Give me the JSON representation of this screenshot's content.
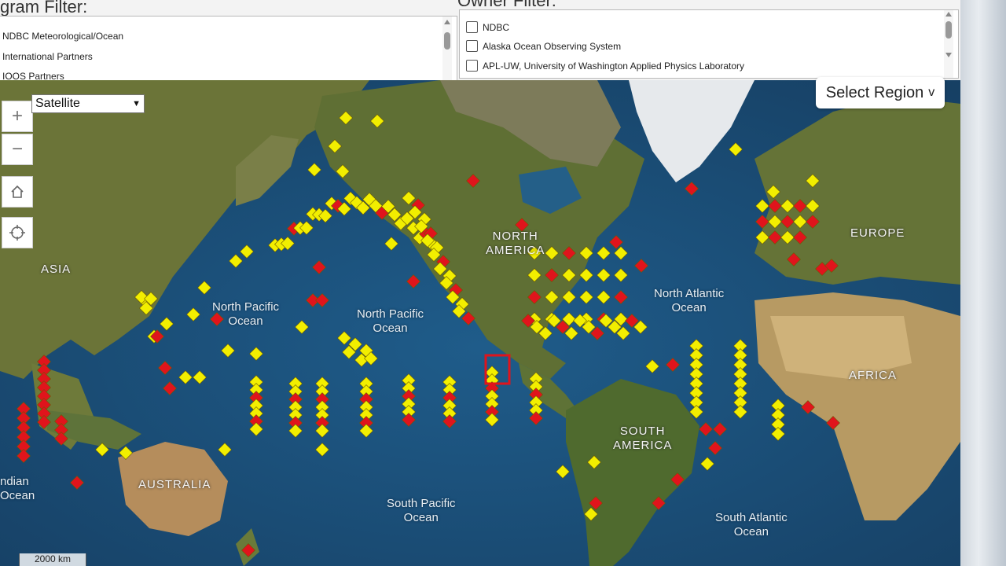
{
  "program_filter": {
    "title": "gram Filter:",
    "options": [
      "NDBC Meteorological/Ocean",
      "International Partners",
      "IOOS Partners"
    ]
  },
  "owner_filter": {
    "title": "Owner Filter:",
    "options": [
      "NDBC",
      "Alaska Ocean Observing System",
      "APL-UW, University of Washington Applied Physics Laboratory"
    ]
  },
  "map": {
    "basemap_select": "Satellite",
    "region_button": "Select Region",
    "region_chevron": "v",
    "zoom_in": "+",
    "zoom_out": "−",
    "scale_label": "2000 km",
    "labels": {
      "asia": "ASIA",
      "north_america": "NORTH\nAMERICA",
      "europe": "EUROPE",
      "africa": "AFRICA",
      "south_america": "SOUTH\nAMERICA",
      "australia": "AUSTRALIA",
      "north_pacific_w": "North Pacific\nOcean",
      "north_pacific_e": "North Pacific\nOcean",
      "north_atlantic": "North Atlantic\nOcean",
      "south_pacific": "South Pacific\nOcean",
      "south_atlantic": "South Atlantic\nOcean",
      "indian": "ndian\nOcean"
    },
    "icons": {
      "zoom_in": "plus-icon",
      "zoom_out": "minus-icon",
      "home": "home-icon",
      "locate": "crosshair-icon"
    },
    "colors": {
      "active_station": "#f2ee00",
      "alert_station": "#e0141c",
      "ocean": "#1b4f78",
      "land": "#6f7a3c"
    }
  }
}
